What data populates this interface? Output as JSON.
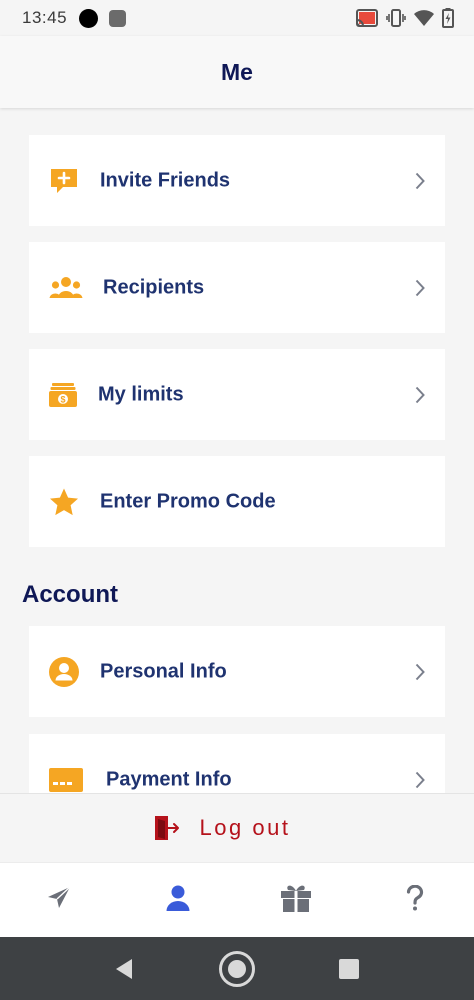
{
  "status_bar": {
    "time": "13:45"
  },
  "header": {
    "title": "Me"
  },
  "menu_items": [
    {
      "label": "Invite Friends",
      "icon": "chat-plus-icon",
      "has_chevron": true
    },
    {
      "label": "Recipients",
      "icon": "people-icon",
      "has_chevron": true
    },
    {
      "label": "My limits",
      "icon": "money-icon",
      "has_chevron": true
    },
    {
      "label": "Enter Promo Code",
      "icon": "star-icon",
      "has_chevron": false
    }
  ],
  "account_section": {
    "title": "Account",
    "items": [
      {
        "label": "Personal Info",
        "icon": "user-circle-icon",
        "has_chevron": true
      },
      {
        "label": "Payment Info",
        "icon": "credit-card-icon",
        "has_chevron": true
      }
    ]
  },
  "logout": {
    "label": "Log out"
  },
  "bottom_nav": [
    {
      "name": "send",
      "icon": "paper-plane-icon",
      "active": false
    },
    {
      "name": "me",
      "icon": "person-icon",
      "active": true
    },
    {
      "name": "rewards",
      "icon": "gift-icon",
      "active": false
    },
    {
      "name": "help",
      "icon": "question-icon",
      "active": false
    }
  ],
  "colors": {
    "accent_orange": "#f5a623",
    "title_navy": "#0f1856",
    "label_blue": "#1f3370",
    "logout_red": "#b5121b",
    "nav_active": "#3a5bd9",
    "nav_inactive": "#6b6f78"
  }
}
